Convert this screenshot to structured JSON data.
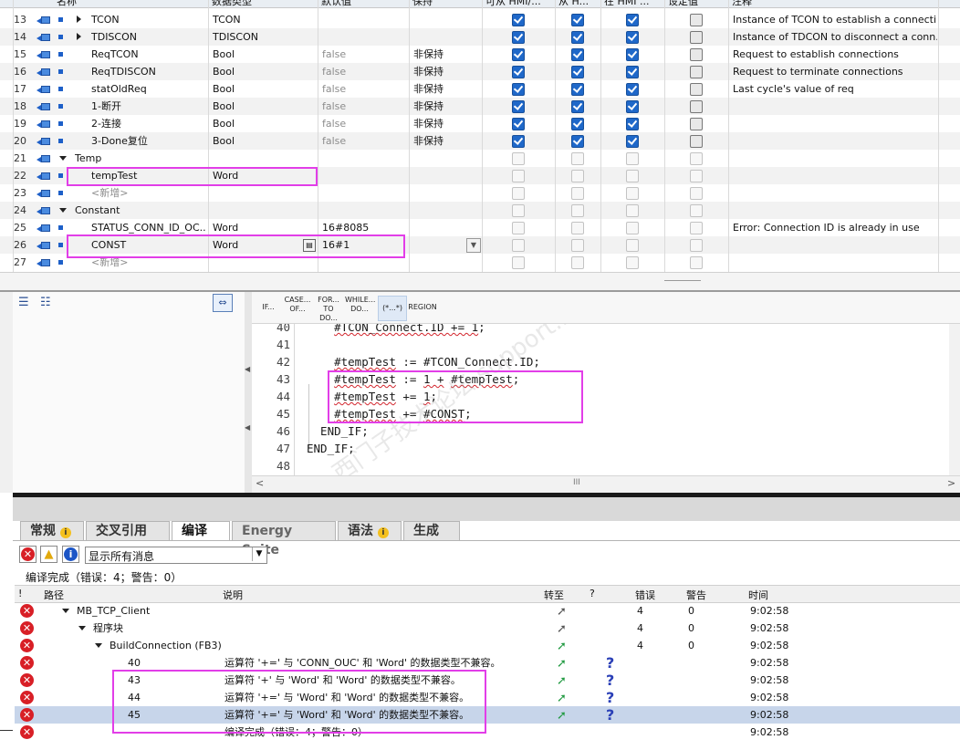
{
  "table": {
    "headers": {
      "name": "名称",
      "datatype": "数据类型",
      "default": "默认值",
      "retain": "保持",
      "hmi_access": "可从 HMI/...",
      "hmi_write": "从 H...",
      "hmi_visible": "在 HMI ...",
      "setpoint": "设定值",
      "comment": "注释"
    },
    "rows": [
      {
        "num": "13",
        "name": "TCON",
        "type": "TCON",
        "default": "",
        "retain": "",
        "comment": "Instance of TCON to establish a connecti..."
      },
      {
        "num": "14",
        "name": "TDISCON",
        "type": "TDISCON",
        "default": "",
        "retain": "",
        "comment": "Instance of TDCON to disconnect a conn..."
      },
      {
        "num": "15",
        "name": "ReqTCON",
        "type": "Bool",
        "default": "false",
        "retain": "非保持",
        "comment": "Request to establish connections"
      },
      {
        "num": "16",
        "name": "ReqTDISCON",
        "type": "Bool",
        "default": "false",
        "retain": "非保持",
        "comment": "Request to terminate connections"
      },
      {
        "num": "17",
        "name": "statOldReq",
        "type": "Bool",
        "default": "false",
        "retain": "非保持",
        "comment": "Last cycle's value of req"
      },
      {
        "num": "18",
        "name": "1-断开",
        "type": "Bool",
        "default": "false",
        "retain": "非保持",
        "comment": ""
      },
      {
        "num": "19",
        "name": "2-连接",
        "type": "Bool",
        "default": "false",
        "retain": "非保持",
        "comment": ""
      },
      {
        "num": "20",
        "name": "3-Done复位",
        "type": "Bool",
        "default": "false",
        "retain": "非保持",
        "comment": ""
      },
      {
        "num": "21",
        "name": "Temp",
        "type": "",
        "default": "",
        "retain": "",
        "comment": ""
      },
      {
        "num": "22",
        "name": "tempTest",
        "type": "Word",
        "default": "",
        "retain": "",
        "comment": ""
      },
      {
        "num": "23",
        "name": "<新增>",
        "type": "",
        "default": "",
        "retain": "",
        "comment": ""
      },
      {
        "num": "24",
        "name": "Constant",
        "type": "",
        "default": "",
        "retain": "",
        "comment": ""
      },
      {
        "num": "25",
        "name": "STATUS_CONN_ID_OC...",
        "type": "Word",
        "default": "16#8085",
        "retain": "",
        "comment": "Error: Connection ID is already in use"
      },
      {
        "num": "26",
        "name": "CONST",
        "type": "Word",
        "default": "16#1",
        "retain": "",
        "comment": ""
      },
      {
        "num": "27",
        "name": "<新增>",
        "type": "",
        "default": "",
        "retain": "",
        "comment": ""
      }
    ]
  },
  "toolbar": {
    "if": "IF...",
    "case1": "CASE...",
    "case2": "OF...",
    "for1": "FOR...",
    "for2": "TO DO...",
    "while1": "WHILE...",
    "while2": "DO...",
    "comment": "(*...*)",
    "region": "REGION"
  },
  "code": {
    "lines": [
      {
        "n": "40",
        "text": "    #TCON_Connect.ID += 1;"
      },
      {
        "n": "41",
        "text": ""
      },
      {
        "n": "42",
        "text": "    #tempTest := #TCON_Connect.ID;"
      },
      {
        "n": "43",
        "text": "    #tempTest := 1 + #tempTest;"
      },
      {
        "n": "44",
        "text": "    #tempTest += 1;"
      },
      {
        "n": "45",
        "text": "    #tempTest += #CONST;"
      },
      {
        "n": "46",
        "text": "  END_IF;"
      },
      {
        "n": "47",
        "text": "END_IF;"
      },
      {
        "n": "48",
        "text": ""
      }
    ]
  },
  "watermark": "西门子技术论坛 support.industry.siemens.com/cs",
  "tabs": {
    "general": "常规",
    "xref": "交叉引用",
    "compile": "编译",
    "energy": "Energy Suite",
    "syntax": "语法",
    "generate": "生成"
  },
  "filter": {
    "value": "显示所有消息"
  },
  "status_line": "编译完成（错误：4；警告：0）",
  "msg_headers": {
    "excl": "!",
    "path": "路径",
    "desc": "说明",
    "goto": "转至",
    "q": "?",
    "errors": "错误",
    "warnings": "警告",
    "time": "时间"
  },
  "messages": [
    {
      "path": "MB_TCP_Client",
      "desc": "",
      "err": "4",
      "warn": "0",
      "time": "9:02:58"
    },
    {
      "path": "程序块",
      "desc": "",
      "err": "4",
      "warn": "0",
      "time": "9:02:58"
    },
    {
      "path": "BuildConnection (FB3)",
      "desc": "",
      "err": "4",
      "warn": "0",
      "time": "9:02:58"
    },
    {
      "path": "40",
      "desc": "运算符 '+=' 与 'CONN_OUC' 和 'Word' 的数据类型不兼容。",
      "err": "",
      "warn": "",
      "time": "9:02:58"
    },
    {
      "path": "43",
      "desc": "运算符 '+' 与 'Word' 和 'Word' 的数据类型不兼容。",
      "err": "",
      "warn": "",
      "time": "9:02:58"
    },
    {
      "path": "44",
      "desc": "运算符 '+=' 与 'Word' 和 'Word' 的数据类型不兼容。",
      "err": "",
      "warn": "",
      "time": "9:02:58"
    },
    {
      "path": "45",
      "desc": "运算符 '+=' 与 'Word' 和 'Word' 的数据类型不兼容。",
      "err": "",
      "warn": "",
      "time": "9:02:58"
    },
    {
      "path": "",
      "desc": "编译完成（错误：4；警告：0）",
      "err": "",
      "warn": "",
      "time": "9:02:58"
    }
  ],
  "colors": {
    "highlight": "#e23ee8",
    "error": "#d81f26",
    "check": "#1f68c9",
    "selected_row": "#c7d5ea"
  }
}
